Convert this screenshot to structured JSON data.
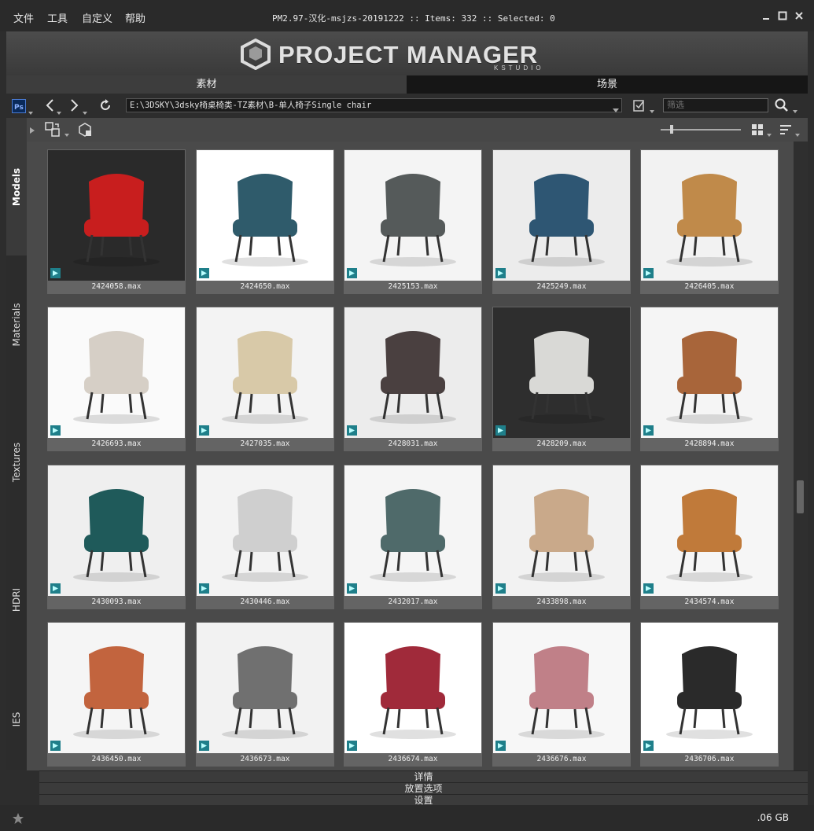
{
  "menu": [
    "文件",
    "工具",
    "自定义",
    "帮助"
  ],
  "title_info": "PM2.97-汉化-msjzs-20191222  :: Items: 332  :: Selected: 0",
  "logo": {
    "text": "PROJECT MANAGER",
    "sub": "KSTUDIO"
  },
  "tabs": [
    {
      "label": "素材",
      "active": true
    },
    {
      "label": "场景",
      "active": false
    }
  ],
  "toolbar": {
    "path": "E:\\3DSKY\\3dsky椅桌椅类-TZ素材\\B-单人椅子Single chair",
    "filter_placeholder": "筛选"
  },
  "sidebar": [
    "Models",
    "Materials",
    "Textures",
    "HDRI",
    "IES"
  ],
  "items": [
    {
      "name": "2424058.max",
      "bg": "#2a2a2a",
      "chair": "#c81e1e"
    },
    {
      "name": "2424650.max",
      "bg": "#ffffff",
      "chair": "#2f5b6b"
    },
    {
      "name": "2425153.max",
      "bg": "#f4f4f4",
      "chair": "#555a5a"
    },
    {
      "name": "2425249.max",
      "bg": "#ececec",
      "chair": "#2e5673"
    },
    {
      "name": "2426405.max",
      "bg": "#f2f2f2",
      "chair": "#c08a4a"
    },
    {
      "name": "2426693.max",
      "bg": "#fafafa",
      "chair": "#d6cfc6"
    },
    {
      "name": "2427035.max",
      "bg": "#f3f3f3",
      "chair": "#d8c9a8"
    },
    {
      "name": "2428031.max",
      "bg": "#ececec",
      "chair": "#4a4040"
    },
    {
      "name": "2428209.max",
      "bg": "#2e2e2e",
      "chair": "#d9d9d6"
    },
    {
      "name": "2428894.max",
      "bg": "#f5f5f5",
      "chair": "#a8653a"
    },
    {
      "name": "2430093.max",
      "bg": "#efefef",
      "chair": "#1f5a5a"
    },
    {
      "name": "2430446.max",
      "bg": "#f3f3f3",
      "chair": "#cfcfcf"
    },
    {
      "name": "2432017.max",
      "bg": "#f5f5f5",
      "chair": "#4f6a6a"
    },
    {
      "name": "2433898.max",
      "bg": "#f2f2f2",
      "chair": "#c9a98a"
    },
    {
      "name": "2434574.max",
      "bg": "#f6f6f6",
      "chair": "#c07a3a"
    },
    {
      "name": "2436450.max",
      "bg": "#f5f5f5",
      "chair": "#c2643e"
    },
    {
      "name": "2436673.max",
      "bg": "#f2f2f2",
      "chair": "#707070"
    },
    {
      "name": "2436674.max",
      "bg": "#ffffff",
      "chair": "#a02a3a"
    },
    {
      "name": "2436676.max",
      "bg": "#f7f7f7",
      "chair": "#c08088"
    },
    {
      "name": "2436706.max",
      "bg": "#ffffff",
      "chair": "#2a2a2a"
    }
  ],
  "panels": [
    "详情",
    "放置选项",
    "设置"
  ],
  "status": {
    "disk": ".06 GB"
  },
  "colors": {
    "accent": "#1f7f8a",
    "tab_active": "#3c3c3c",
    "tab_inactive": "#1a1a1a"
  }
}
